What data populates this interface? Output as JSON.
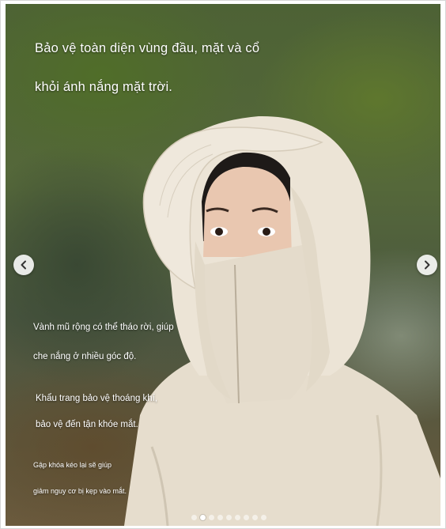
{
  "slide": {
    "headline_line1": "Bảo vệ toàn diện vùng đầu, mặt và cổ",
    "headline_line2": "khỏi ánh nắng mặt trời.",
    "captions": [
      {
        "line1": "Vành mũ rộng có thể tháo rời, giúp",
        "line2": "che nắng ở nhiều góc độ."
      },
      {
        "line1": "Khẩu trang bảo vệ thoáng khí,",
        "line2": "bảo vệ đến tận khóe mắt."
      },
      {
        "line1": "Gập khóa kéo lại sẽ giúp",
        "line2": "giảm nguy cơ bị kẹp vào mắt."
      }
    ]
  },
  "carousel": {
    "prev_icon": "chevron-left-icon",
    "next_icon": "chevron-right-icon",
    "total_slides": 9,
    "active_slide": 2
  },
  "colors": {
    "jacket": "#e9e1d2",
    "text": "#ffffff"
  }
}
